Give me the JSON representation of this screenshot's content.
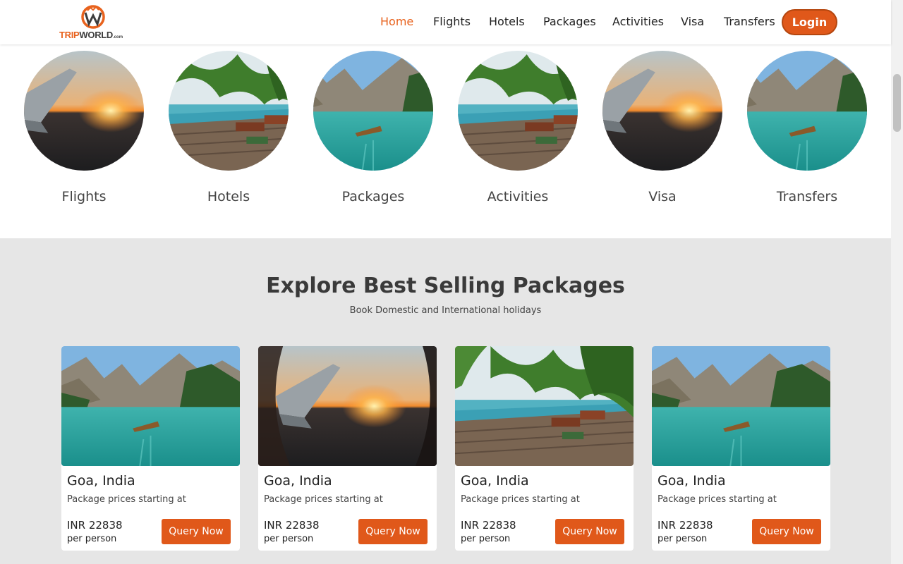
{
  "brand": {
    "part1": "TRIP",
    "part2": "WORLD",
    "suffix": ".com"
  },
  "nav": {
    "items": [
      "Home",
      "Flights",
      "Hotels",
      "Packages",
      "Activities",
      "Visa",
      "Transfers"
    ],
    "active": "Home",
    "login_label": "Login"
  },
  "categories": [
    {
      "label": "Flights",
      "image": "airplane-window-sunset"
    },
    {
      "label": "Hotels",
      "image": "resort-pool-deck"
    },
    {
      "label": "Packages",
      "image": "mountain-lake-boat"
    },
    {
      "label": "Activities",
      "image": "resort-pool-deck"
    },
    {
      "label": "Visa",
      "image": "airplane-window-sunset"
    },
    {
      "label": "Transfers",
      "image": "mountain-lake-boat"
    }
  ],
  "packages": {
    "title": "Explore Best Selling Packages",
    "subtitle": "Book Domestic and International holidays",
    "cards": [
      {
        "destination": "Goa, India",
        "caption": "Package prices starting at",
        "price": "INR 22838",
        "unit": "per person",
        "button": "Query Now",
        "image": "mountain-lake-boat"
      },
      {
        "destination": "Goa, India",
        "caption": "Package prices starting at",
        "price": "INR 22838",
        "unit": "per person",
        "button": "Query Now",
        "image": "airplane-window-sunset"
      },
      {
        "destination": "Goa, India",
        "caption": "Package prices starting at",
        "price": "INR 22838",
        "unit": "per person",
        "button": "Query Now",
        "image": "resort-pool-deck"
      },
      {
        "destination": "Goa, India",
        "caption": "Package prices starting at",
        "price": "INR 22838",
        "unit": "per person",
        "button": "Query Now",
        "image": "mountain-lake-boat"
      }
    ]
  },
  "colors": {
    "accent": "#e0581a",
    "section_bg": "#e6e6e6",
    "text_dark": "#3a3a3a"
  }
}
